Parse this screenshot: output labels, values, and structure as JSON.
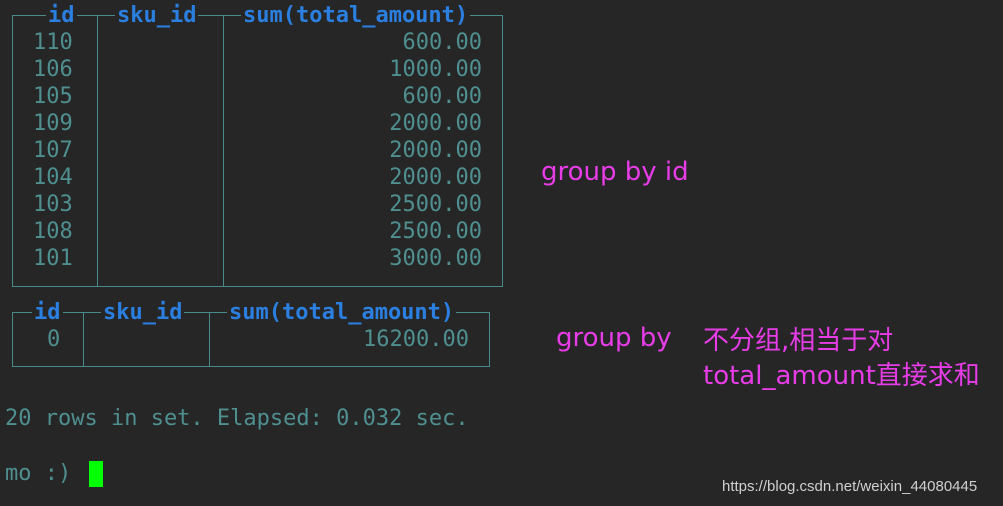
{
  "table1": {
    "headers": [
      "id",
      "sku_id",
      "sum(total_amount)"
    ],
    "rows": [
      {
        "id": "110",
        "sku_id": "",
        "sum": "600.00"
      },
      {
        "id": "106",
        "sku_id": "",
        "sum": "1000.00"
      },
      {
        "id": "105",
        "sku_id": "",
        "sum": "600.00"
      },
      {
        "id": "109",
        "sku_id": "",
        "sum": "2000.00"
      },
      {
        "id": "107",
        "sku_id": "",
        "sum": "2000.00"
      },
      {
        "id": "104",
        "sku_id": "",
        "sum": "2000.00"
      },
      {
        "id": "103",
        "sku_id": "",
        "sum": "2500.00"
      },
      {
        "id": "108",
        "sku_id": "",
        "sum": "2500.00"
      },
      {
        "id": "101",
        "sku_id": "",
        "sum": "3000.00"
      }
    ]
  },
  "table2": {
    "headers": [
      "id",
      "sku_id",
      "sum(total_amount)"
    ],
    "rows": [
      {
        "id": "0",
        "sku_id": "",
        "sum": "16200.00"
      }
    ]
  },
  "annotations": {
    "group_by_id": "group by id",
    "group_by": "group by",
    "note_line1": "不分组,相当于对",
    "note_line2": "total_amount直接求和"
  },
  "status": {
    "summary": "20 rows in set. Elapsed: 0.032 sec.",
    "prompt": "mo :)"
  },
  "watermark": "https://blog.csdn.net/weixin_44080445",
  "colors": {
    "background": "#262626",
    "header": "#2a7fe0",
    "text": "#4f8f8f",
    "annotation": "#e83ce8",
    "cursor": "#00ff00"
  }
}
